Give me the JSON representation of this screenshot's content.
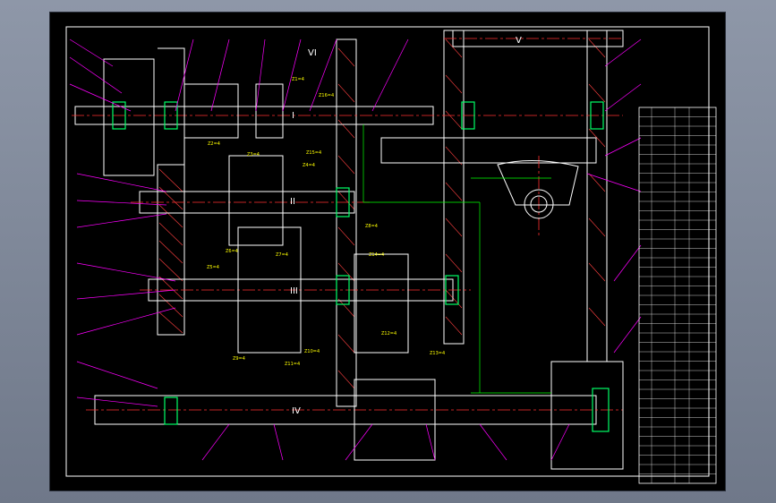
{
  "drawing": {
    "shaft_labels": {
      "i": "I",
      "ii": "II",
      "iii": "III",
      "iv": "IV",
      "v": "V",
      "vi": "VI"
    },
    "gear_labels": [
      "Z1=4",
      "Z2=4",
      "Z3=4",
      "Z4=4",
      "Z5=4",
      "Z6=4",
      "Z7=4",
      "Z8=4",
      "Z9=4",
      "Z10=4",
      "Z11=4",
      "Z12=4",
      "Z13=4",
      "Z14=4",
      "Z15=4",
      "Z16=4"
    ],
    "colors": {
      "background": "#000000",
      "outline": "#ffffff",
      "centerline": "#ff3030",
      "hatch": "#ff4040",
      "leader": "#ff00ff",
      "dimension": "#00ff00",
      "annotation": "#ffff00",
      "bearing": "#00ff66"
    }
  },
  "parts_table": {
    "columns": 4,
    "rows": 40
  }
}
